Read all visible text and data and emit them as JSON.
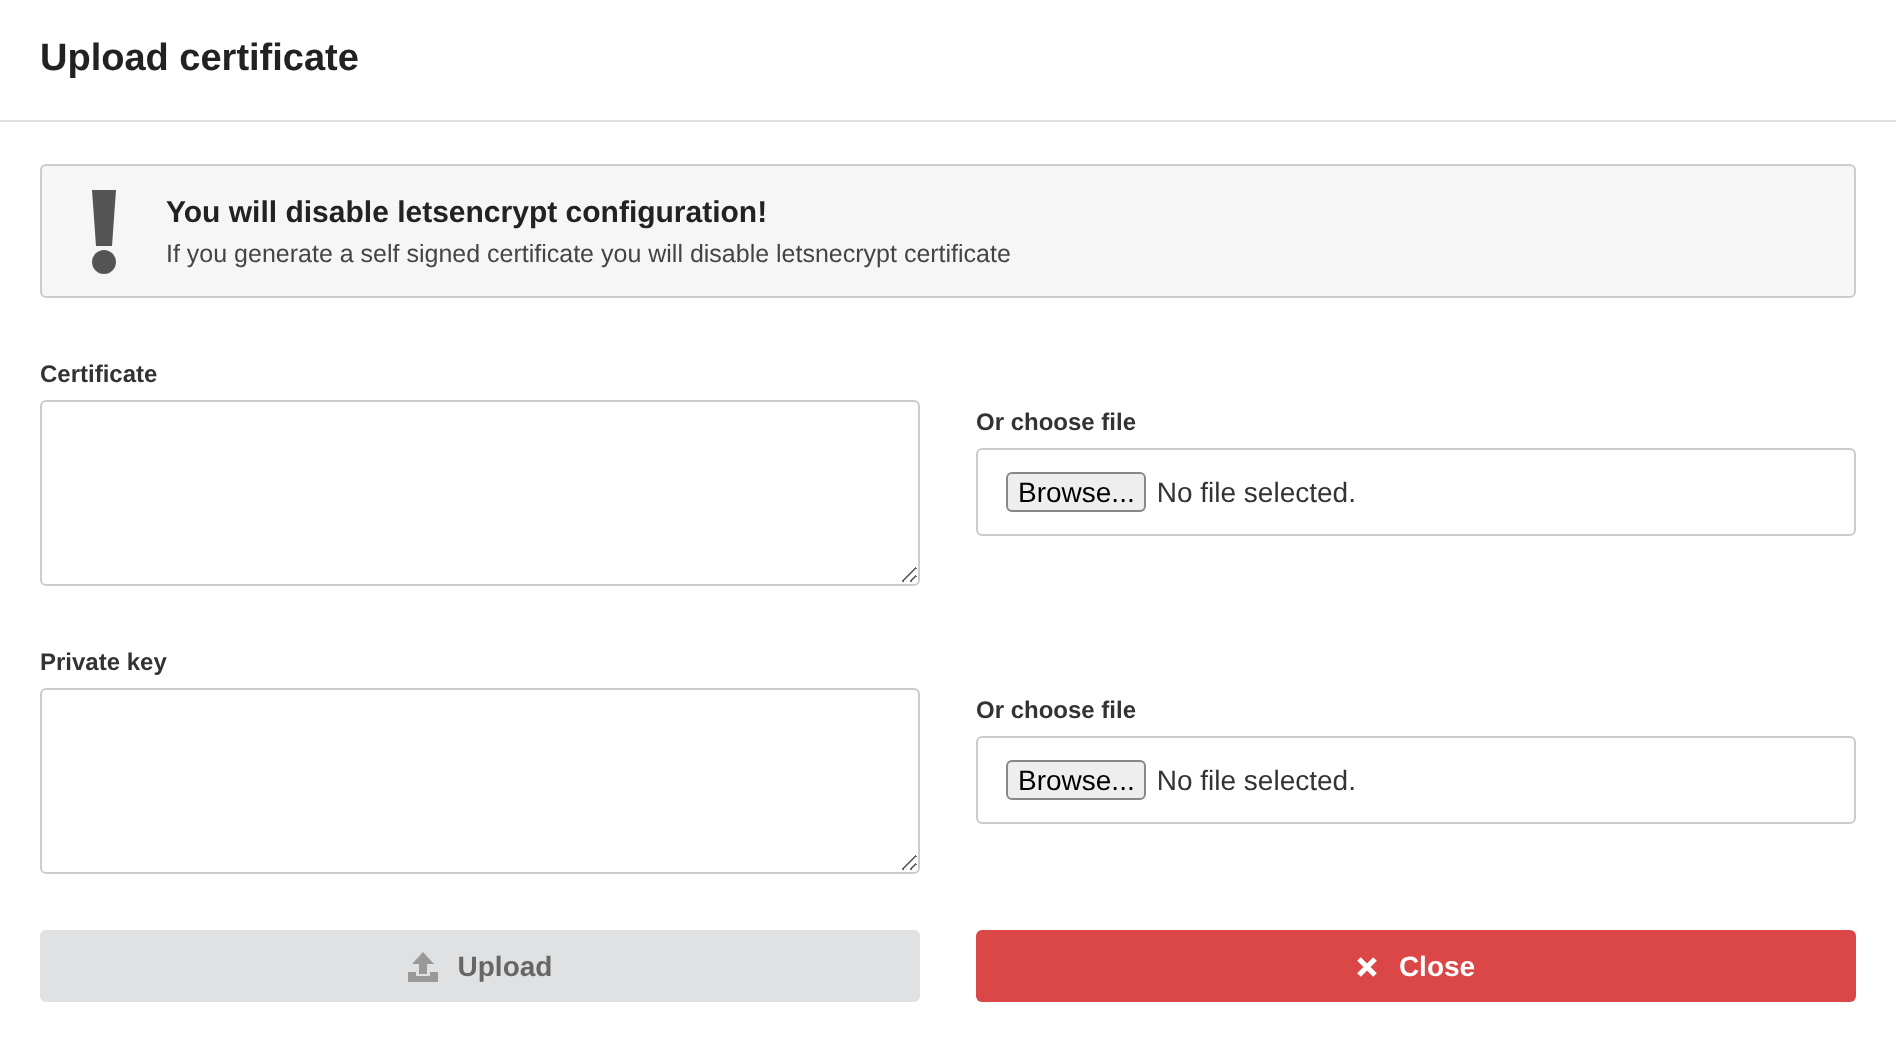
{
  "dialog": {
    "title": "Upload certificate"
  },
  "alert": {
    "title": "You will disable letsencrypt configuration!",
    "message": "If you generate a self signed certificate you will disable letsnecrypt certificate"
  },
  "fields": [
    {
      "label": "Certificate",
      "file_label": "Or choose file",
      "browse": "Browse...",
      "file_status": "No file selected."
    },
    {
      "label": "Private key",
      "file_label": "Or choose file",
      "browse": "Browse...",
      "file_status": "No file selected."
    }
  ],
  "buttons": [
    {
      "kind": "upload",
      "label": "Upload",
      "disabled": true
    },
    {
      "kind": "close",
      "label": "Close",
      "disabled": false
    }
  ]
}
